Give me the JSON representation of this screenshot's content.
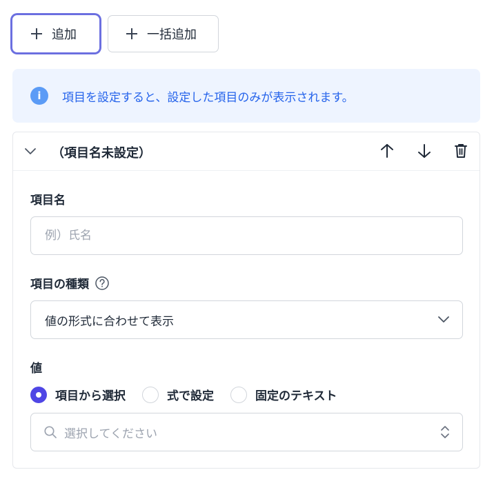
{
  "toolbar": {
    "add_label": "追加",
    "bulk_add_label": "一括追加"
  },
  "info": {
    "text": "項目を設定すると、設定した項目のみが表示されます。",
    "icon_glyph": "i",
    "color": "#2563eb"
  },
  "card": {
    "title": "（項目名未設定）",
    "icons": [
      "chevron-down-icon",
      "arrow-up-icon",
      "arrow-down-icon",
      "trash-icon"
    ]
  },
  "form": {
    "name_label": "項目名",
    "name_placeholder": "例）氏名",
    "name_value": "",
    "type_label": "項目の種類",
    "type_value": "値の形式に合わせて表示",
    "value_label": "値",
    "value_options": [
      {
        "label": "項目から選択",
        "selected": true
      },
      {
        "label": "式で設定",
        "selected": false
      },
      {
        "label": "固定のテキスト",
        "selected": false
      }
    ],
    "select_placeholder": "選択してください"
  },
  "colors": {
    "accent": "#4f46e5",
    "focus_ring": "#6b6fe0",
    "info_bg": "#eef4ff"
  }
}
